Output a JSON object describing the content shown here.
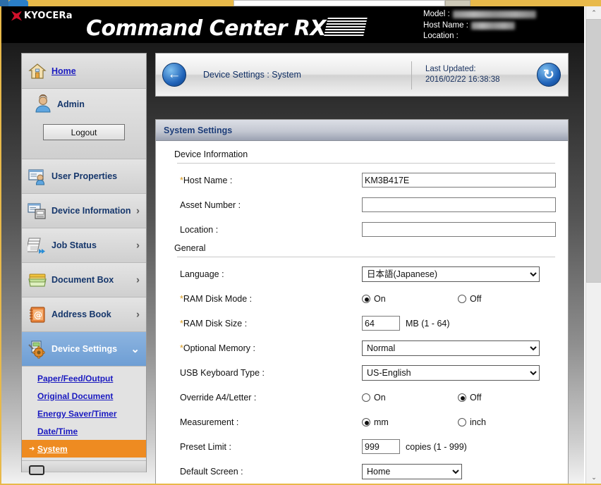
{
  "banner": {
    "logo_word": "KYOCERa",
    "product_title": "Command Center RX",
    "meta": {
      "model_label": "Model :",
      "model_value": "",
      "hostname_label": "Host Name :",
      "hostname_value": "",
      "location_label": "Location :",
      "location_value": ""
    }
  },
  "sidebar": {
    "home_label": "Home",
    "user_label": "Admin",
    "logout_label": "Logout",
    "items": [
      {
        "label": "User Properties",
        "chevron": ""
      },
      {
        "label": "Device Information",
        "chevron": "›"
      },
      {
        "label": "Job Status",
        "chevron": "›"
      },
      {
        "label": "Document Box",
        "chevron": "›"
      },
      {
        "label": "Address Book",
        "chevron": "›"
      },
      {
        "label": "Device Settings",
        "chevron": "⌄"
      }
    ],
    "submenu": [
      {
        "label": "Paper/Feed/Output",
        "active": false
      },
      {
        "label": "Original Document",
        "active": false
      },
      {
        "label": "Energy Saver/Timer",
        "active": false
      },
      {
        "label": "Date/Time",
        "active": false
      },
      {
        "label": "System",
        "active": true
      }
    ],
    "active_marker": "➜"
  },
  "crumb": {
    "back_icon": "←",
    "title": "Device Settings : System",
    "last_updated_label": "Last Updated:",
    "last_updated_value": "2016/02/22 16:38:38",
    "refresh_icon": "↻"
  },
  "panel": {
    "title": "System Settings",
    "sections": [
      {
        "title": "Device Information",
        "rows": [
          {
            "label": "Host Name :",
            "required": true,
            "type": "text",
            "value": "KM3B417E",
            "width": "wide"
          },
          {
            "label": "Asset Number :",
            "required": false,
            "type": "text",
            "value": "",
            "width": "wide"
          },
          {
            "label": "Location :",
            "required": false,
            "type": "text",
            "value": "",
            "width": "wide"
          }
        ]
      },
      {
        "title": "General",
        "rows": [
          {
            "label": "Language :",
            "required": false,
            "type": "select",
            "value": "日本語(Japanese)",
            "width": "wide"
          },
          {
            "label": "RAM Disk Mode :",
            "required": true,
            "type": "radio",
            "options": [
              "On",
              "Off"
            ],
            "selected": 0
          },
          {
            "label": "RAM Disk Size :",
            "required": true,
            "type": "text",
            "value": "64",
            "width": "small",
            "unit": "MB (1 - 64)"
          },
          {
            "label": "Optional Memory :",
            "required": true,
            "type": "select",
            "value": "Normal",
            "width": "wide"
          },
          {
            "label": "USB Keyboard Type :",
            "required": false,
            "type": "select",
            "value": "US-English",
            "width": "wide"
          },
          {
            "label": "Override A4/Letter :",
            "required": false,
            "type": "radio",
            "options": [
              "On",
              "Off"
            ],
            "selected": 1
          },
          {
            "label": "Measurement :",
            "required": false,
            "type": "radio",
            "options": [
              "mm",
              "inch"
            ],
            "selected": 0
          },
          {
            "label": "Preset Limit :",
            "required": false,
            "type": "text",
            "value": "999",
            "width": "small",
            "unit": "copies (1 - 999)"
          },
          {
            "label": "Default Screen :",
            "required": false,
            "type": "select",
            "value": "Home",
            "width": "narrow"
          }
        ]
      }
    ]
  },
  "scrollbar": {
    "up_arrow": "⌃",
    "down_arrow": "⌄"
  },
  "colors": {
    "accent_orange": "#ee8b21",
    "accent_blue": "#6e9ed4",
    "link_blue": "#1a1ac0",
    "kyocera_red": "#d0112b",
    "frame_gold": "#e8b94a"
  }
}
